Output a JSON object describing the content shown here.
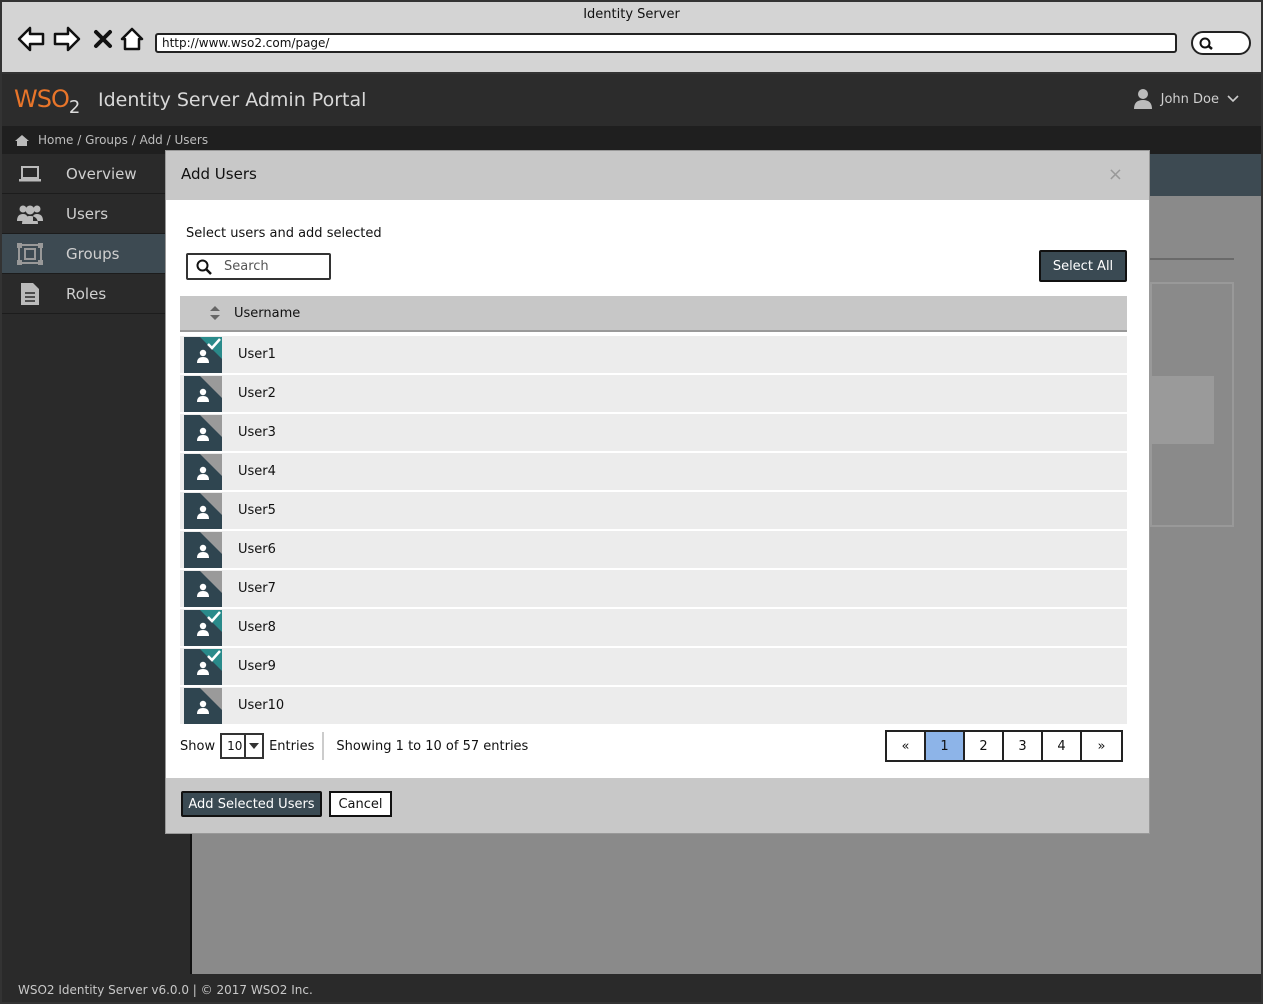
{
  "browser": {
    "window_title": "Identity Server",
    "url": "http://www.wso2.com/page/"
  },
  "app": {
    "logo_text": "WSO",
    "logo_sub": "2",
    "title": "Identity Server Admin Portal",
    "user_name": "John Doe"
  },
  "breadcrumb": "Home / Groups / Add / Users",
  "sidebar": {
    "items": [
      {
        "label": "Overview",
        "icon": "laptop-icon",
        "active": false
      },
      {
        "label": "Users",
        "icon": "users-icon",
        "active": false
      },
      {
        "label": "Groups",
        "icon": "groups-icon",
        "active": true
      },
      {
        "label": "Roles",
        "icon": "document-icon",
        "active": false
      }
    ]
  },
  "modal": {
    "title": "Add Users",
    "close_glyph": "×",
    "instruction": "Select users and add selected",
    "search_placeholder": "Search",
    "select_all_label": "Select All",
    "column_header": "Username",
    "users": [
      {
        "name": "User1",
        "selected": true
      },
      {
        "name": "User2",
        "selected": false
      },
      {
        "name": "User3",
        "selected": false
      },
      {
        "name": "User4",
        "selected": false
      },
      {
        "name": "User5",
        "selected": false
      },
      {
        "name": "User6",
        "selected": false
      },
      {
        "name": "User7",
        "selected": false
      },
      {
        "name": "User8",
        "selected": true
      },
      {
        "name": "User9",
        "selected": true
      },
      {
        "name": "User10",
        "selected": false
      }
    ],
    "show_label": "Show",
    "page_size": "10",
    "entries_label": "Entries",
    "showing_text": "Showing 1 to 10 of 57 entries",
    "pagination": [
      "«",
      "1",
      "2",
      "3",
      "4",
      "»"
    ],
    "current_page": "1",
    "add_button_label": "Add Selected Users",
    "cancel_button_label": "Cancel"
  },
  "footer": "WSO2 Identity Server v6.0.0 | © 2017 WSO2 Inc.",
  "colors": {
    "header_bg": "#2c2c2c",
    "accent_dark": "#3a4a53",
    "logo_orange": "#e8752a",
    "active_page": "#8db4e8",
    "check_teal": "#2a8a8a"
  }
}
